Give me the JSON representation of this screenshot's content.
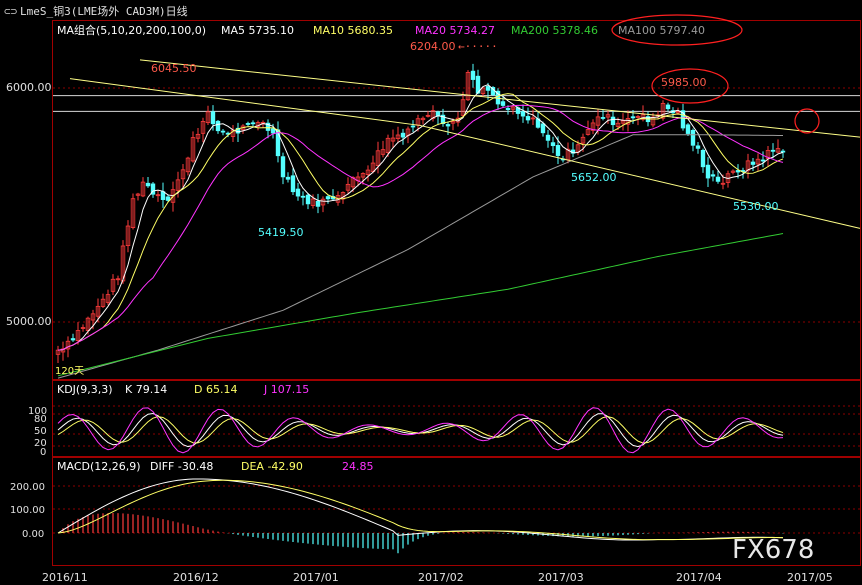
{
  "window": {
    "title": "LmeS_铜3(LME场外 CAD3M)日线"
  },
  "legend_main": {
    "ma_group": "MA组合(5,10,20,200,100,0)",
    "ma5": "MA5 5735.10",
    "ma10": "MA10 5680.35",
    "ma20": "MA20 5734.27",
    "ma200": "MA200 5378.46",
    "ma100": "MA100 5797.40"
  },
  "legend_kdj": {
    "title": "KDJ(9,3,3)",
    "k": "K 79.14",
    "d": "D 65.14",
    "j": "J 107.15"
  },
  "legend_macd": {
    "title": "MACD(12,26,9)",
    "diff": "DIFF -30.48",
    "dea": "DEA -42.90",
    "macd": "24.85"
  },
  "watermark": "FX678",
  "colors": {
    "up": "#ff3b3b",
    "down": "#54ffff",
    "ma5": "#ffffff",
    "ma10": "#ffff66",
    "ma20": "#ff33ff",
    "ma100": "#9a9a9a",
    "ma200": "#33cc33",
    "trend": "#ffff88",
    "grid": "#8b0000",
    "circle": "#ff2020"
  },
  "chart_data": {
    "type": "candlestick",
    "title": "LmeS_铜3(LME场外 CAD3M)日线",
    "x_ticks": [
      "2016/11",
      "2016/12",
      "2017/01",
      "2017/02",
      "2017/03",
      "2017/04",
      "2017/05"
    ],
    "y_ticks": [
      "6000.00",
      "5000.00"
    ],
    "annotations": [
      "6045.50",
      "6204.00",
      "5985.00",
      "5419.50",
      "5652.00",
      "5530.00",
      "120天"
    ],
    "kdj_ticks": [
      "100",
      "80",
      "50",
      "20",
      "0"
    ],
    "macd_ticks": [
      "200.00",
      "100.00",
      "0.00"
    ],
    "close_path": [
      [
        0,
        4880
      ],
      [
        4,
        4960
      ],
      [
        8,
        5060
      ],
      [
        12,
        5200
      ],
      [
        15,
        5520
      ],
      [
        17,
        5600
      ],
      [
        19,
        5560
      ],
      [
        22,
        5530
      ],
      [
        25,
        5640
      ],
      [
        27,
        5790
      ],
      [
        30,
        5880
      ],
      [
        32,
        5820
      ],
      [
        35,
        5810
      ],
      [
        38,
        5830
      ],
      [
        41,
        5860
      ],
      [
        43,
        5800
      ],
      [
        45,
        5640
      ],
      [
        48,
        5540
      ],
      [
        51,
        5510
      ],
      [
        54,
        5520
      ],
      [
        57,
        5570
      ],
      [
        60,
        5620
      ],
      [
        63,
        5690
      ],
      [
        66,
        5780
      ],
      [
        69,
        5810
      ],
      [
        72,
        5860
      ],
      [
        75,
        5920
      ],
      [
        78,
        5840
      ],
      [
        80,
        5870
      ],
      [
        82,
        6060
      ],
      [
        84,
        5980
      ],
      [
        86,
        5990
      ],
      [
        88,
        5930
      ],
      [
        91,
        5900
      ],
      [
        93,
        5870
      ],
      [
        96,
        5850
      ],
      [
        98,
        5770
      ],
      [
        101,
        5700
      ],
      [
        103,
        5740
      ],
      [
        106,
        5830
      ],
      [
        109,
        5880
      ],
      [
        112,
        5850
      ],
      [
        115,
        5890
      ],
      [
        118,
        5860
      ],
      [
        121,
        5920
      ],
      [
        124,
        5890
      ],
      [
        126,
        5790
      ],
      [
        128,
        5730
      ],
      [
        130,
        5630
      ],
      [
        133,
        5600
      ],
      [
        136,
        5650
      ],
      [
        139,
        5680
      ],
      [
        142,
        5720
      ],
      [
        145,
        5745
      ]
    ],
    "ma200_path": [
      [
        0,
        4770
      ],
      [
        30,
        4930
      ],
      [
        60,
        5040
      ],
      [
        90,
        5140
      ],
      [
        120,
        5280
      ],
      [
        145,
        5378
      ]
    ],
    "ma100_path": [
      [
        0,
        4760
      ],
      [
        20,
        4880
      ],
      [
        45,
        5050
      ],
      [
        70,
        5310
      ],
      [
        95,
        5620
      ],
      [
        115,
        5800
      ],
      [
        130,
        5800
      ],
      [
        145,
        5797
      ]
    ]
  }
}
